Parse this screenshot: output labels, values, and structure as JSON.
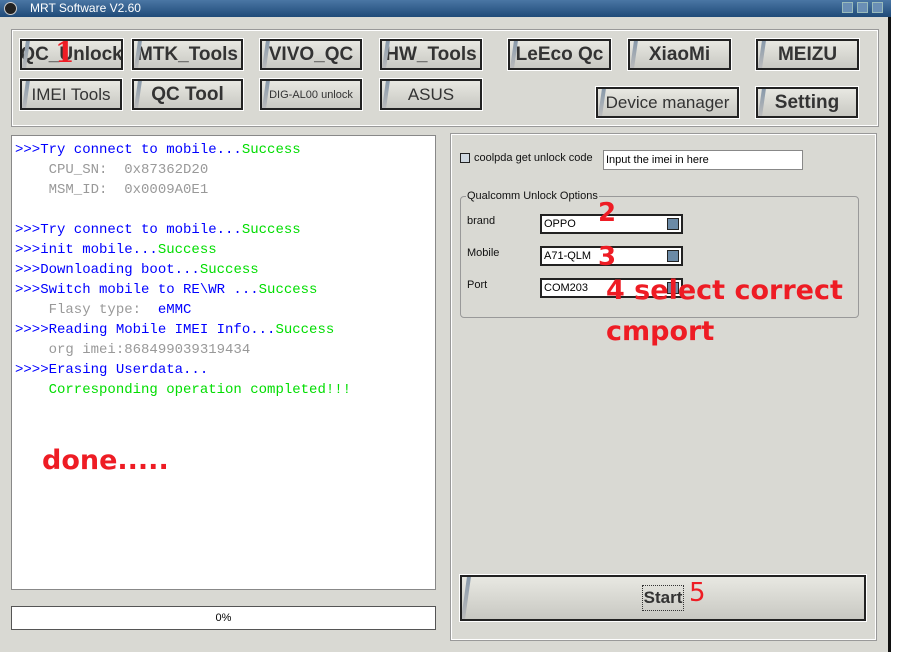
{
  "window": {
    "title": "MRT Software V2.60"
  },
  "toolbar": {
    "row1": [
      "QC_Unlock",
      "MTK_Tools",
      "VIVO_QC",
      "HW_Tools",
      "LeEco Qc",
      "XiaoMi",
      "MEIZU"
    ],
    "row2": [
      "IMEI Tools",
      "QC Tool",
      "DIG-AL00 unlock",
      "ASUS",
      "Device manager",
      "Setting"
    ]
  },
  "log": [
    [
      [
        "b",
        ">>>Try connect to mobile..."
      ],
      [
        "g",
        "Success"
      ]
    ],
    [
      [
        "gr",
        "    CPU_SN:  0x87362D20"
      ]
    ],
    [
      [
        "gr",
        "    MSM_ID:  0x0009A0E1"
      ]
    ],
    [
      [
        "gr",
        " "
      ]
    ],
    [
      [
        "b",
        ">>>Try connect to mobile..."
      ],
      [
        "g",
        "Success"
      ]
    ],
    [
      [
        "b",
        ">>>init mobile..."
      ],
      [
        "g",
        "Success"
      ]
    ],
    [
      [
        "b",
        ">>>Downloading boot..."
      ],
      [
        "g",
        "Success"
      ]
    ],
    [
      [
        "b",
        ">>>Switch mobile to RE\\WR ..."
      ],
      [
        "g",
        "Success"
      ]
    ],
    [
      [
        "gr",
        "    Flasy type:  "
      ],
      [
        "b",
        "eMMC"
      ]
    ],
    [
      [
        "b",
        ">>>>Reading Mobile IMEI Info..."
      ],
      [
        "g",
        "Success"
      ]
    ],
    [
      [
        "gr",
        "    org imei:868499039319434"
      ]
    ],
    [
      [
        "b",
        ">>>>Erasing Userdata..."
      ]
    ],
    [
      [
        "g",
        "    Corresponding operation completed!!!"
      ]
    ]
  ],
  "progress": {
    "value": 0,
    "label": "0%"
  },
  "coolpad": {
    "checkbox_label": "coolpda get unlock code",
    "checked": false,
    "input_value": "Input the imei in here"
  },
  "qualcomm": {
    "group_label": "Qualcomm Unlock Options",
    "brand_label": "brand",
    "brand_value": "OPPO",
    "mobile_label": "Mobile",
    "mobile_value": "A71-QLM",
    "port_label": "Port",
    "port_value": "COM203"
  },
  "start_label": "Start",
  "annotations": {
    "a1": "1",
    "a2": "2",
    "a3": "3",
    "a4": "4 select correct",
    "a4b": "cmport",
    "done": "done.....",
    "a5": "5"
  },
  "colors": {
    "accent_red": "#ee1c24",
    "log_blue": "#0000ff",
    "log_green": "#00dd00"
  }
}
